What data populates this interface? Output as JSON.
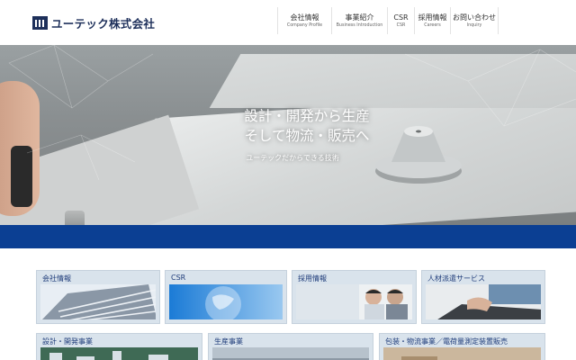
{
  "header": {
    "logo_text": "ユーテック株式会社",
    "nav": [
      {
        "jp": "会社情報",
        "en": "Company Profile"
      },
      {
        "jp": "事業紹介",
        "en": "Business Introduction"
      },
      {
        "jp": "CSR",
        "en": "CSR"
      },
      {
        "jp": "採用情報",
        "en": "Careers"
      },
      {
        "jp": "お問い合わせ",
        "en": "Inquiry"
      }
    ]
  },
  "hero": {
    "title_line1": "設計・開発から生産",
    "title_line2": "そして物流・販売へ",
    "subtitle": "ユーテックだからできる技術"
  },
  "cards": [
    {
      "label": "会社情報",
      "icon": "building-photo"
    },
    {
      "label": "CSR",
      "icon": "globe-photo"
    },
    {
      "label": "採用情報",
      "icon": "people-photo"
    },
    {
      "label": "人材派遣サービス",
      "icon": "keyboard-photo"
    },
    {
      "label": "設計・開発事業",
      "icon": "circuit-photo"
    },
    {
      "label": "生産事業",
      "icon": "factory-photo"
    },
    {
      "label": "包装・物流事業／電荷量測定装置販売",
      "icon": "logistics-photo"
    }
  ],
  "colors": {
    "brand_navy": "#1d2f5a",
    "band_blue": "#0b3f93",
    "card_bg": "#d9e3ec",
    "card_label": "#1f3c7a"
  }
}
